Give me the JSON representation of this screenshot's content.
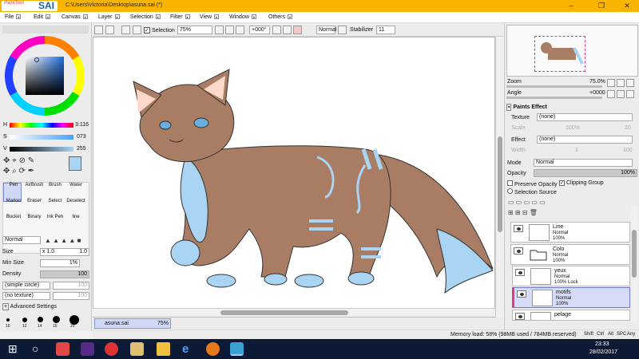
{
  "window": {
    "app_logo_small": "PaintTool",
    "app_logo_big": "SAI",
    "path": "C:\\Users\\Victoria\\Desktop\\asuna.sai (*)"
  },
  "menu": [
    "File",
    "Edit",
    "Canvas",
    "Layer",
    "Selection",
    "Filter",
    "View",
    "Window",
    "Others"
  ],
  "left": {
    "h_label": "H",
    "h_value": "3:116",
    "s_label": "S",
    "s_value": "073",
    "v_label": "V",
    "v_value": "255",
    "brushes": [
      [
        "Pen",
        "AirBrush",
        "Brush",
        "Water"
      ],
      [
        "Marker",
        "Eraser",
        "Select",
        "Deselect"
      ],
      [
        "Bucket",
        "Binary",
        "Ink Pen",
        "line"
      ]
    ],
    "blend_mode": "Normal",
    "size_label": "Size",
    "size_mult": "x 1.0",
    "size_value": "1.0",
    "minsize_label": "Min Size",
    "minsize_value": "1%",
    "density_label": "Density",
    "density_value": "100",
    "shape": "(simple circle)",
    "shape_val": "100",
    "texture": "(no texture)",
    "texture_val": "100",
    "advanced": "Advanced Settings",
    "dot_sizes": [
      "10",
      "12",
      "14",
      "16",
      "20"
    ]
  },
  "toolbar": {
    "selection_label": "Selection",
    "zoom": "75%",
    "angle": "+000°",
    "mode": "Normal",
    "stabilizer_label": "Stabilizer",
    "stabilizer_value": "11"
  },
  "doc_tab": {
    "name": "asuna.sai",
    "zoom": "75%"
  },
  "right": {
    "zoom_label": "Zoom",
    "zoom_value": "75.0%",
    "angle_label": "Angle",
    "angle_value": "+0000",
    "paints_effect": "Paints Effect",
    "texture_label": "Texture",
    "texture_value": "(none)",
    "scale_label": "Scale",
    "scale_value": "100%",
    "scale_num": "20",
    "effect_label": "Effect",
    "effect_value": "(none)",
    "width_label": "Width",
    "width_value": "1",
    "width_num": "100",
    "mode_label": "Mode",
    "mode_value": "Normal",
    "opacity_label": "Opacity",
    "opacity_value": "100%",
    "preserve": "Preserve Opacity",
    "clipping": "Clipping Group",
    "selsource": "Selection Source",
    "layers": [
      {
        "name": "Line",
        "mode": "Normal",
        "opacity": "100%"
      },
      {
        "name": "Colo",
        "mode": "Normal",
        "opacity": "100%"
      },
      {
        "name": "yeux",
        "mode": "Normal",
        "opacity": "100% Lock"
      },
      {
        "name": "motifs",
        "mode": "Normal",
        "opacity": "100%"
      },
      {
        "name": "pelage",
        "mode": "",
        "opacity": ""
      }
    ]
  },
  "status": {
    "memory": "Memory load: 58% (98MB used / 784MB reserved)",
    "keys": [
      "Shift",
      "Ctrl",
      "Alt",
      "SPC",
      "Any"
    ]
  },
  "taskbar": {
    "time": "23:33",
    "date": "28/02/2017"
  },
  "colors": {
    "title": "#f9b400",
    "fur": "#a97c64",
    "blue": "#aad4f4",
    "taskbar": "#0c1a36"
  }
}
